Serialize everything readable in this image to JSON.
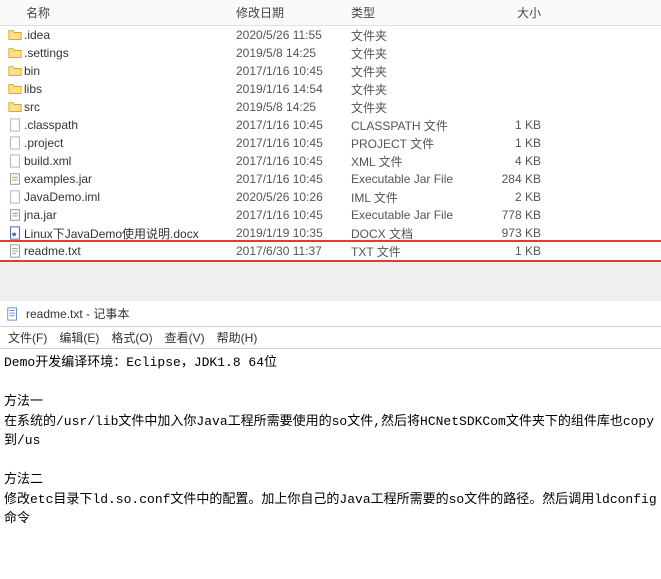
{
  "explorer": {
    "columns": {
      "name": "名称",
      "date": "修改日期",
      "type": "类型",
      "size": "大小"
    },
    "items": [
      {
        "icon": "folder",
        "name": ".idea",
        "date": "2020/5/26 11:55",
        "type": "文件夹",
        "size": ""
      },
      {
        "icon": "folder",
        "name": ".settings",
        "date": "2019/5/8 14:25",
        "type": "文件夹",
        "size": ""
      },
      {
        "icon": "folder",
        "name": "bin",
        "date": "2017/1/16 10:45",
        "type": "文件夹",
        "size": ""
      },
      {
        "icon": "folder",
        "name": "libs",
        "date": "2019/1/16 14:54",
        "type": "文件夹",
        "size": ""
      },
      {
        "icon": "folder",
        "name": "src",
        "date": "2019/5/8 14:25",
        "type": "文件夹",
        "size": ""
      },
      {
        "icon": "file",
        "name": ".classpath",
        "date": "2017/1/16 10:45",
        "type": "CLASSPATH 文件",
        "size": "1 KB"
      },
      {
        "icon": "file",
        "name": ".project",
        "date": "2017/1/16 10:45",
        "type": "PROJECT 文件",
        "size": "1 KB"
      },
      {
        "icon": "file",
        "name": "build.xml",
        "date": "2017/1/16 10:45",
        "type": "XML 文件",
        "size": "4 KB"
      },
      {
        "icon": "jar",
        "name": "examples.jar",
        "date": "2017/1/16 10:45",
        "type": "Executable Jar File",
        "size": "284 KB"
      },
      {
        "icon": "file",
        "name": "JavaDemo.iml",
        "date": "2020/5/26 10:26",
        "type": "IML 文件",
        "size": "2 KB"
      },
      {
        "icon": "jar",
        "name": "jna.jar",
        "date": "2017/1/16 10:45",
        "type": "Executable Jar File",
        "size": "778 KB"
      },
      {
        "icon": "docx",
        "name": "Linux下JavaDemo使用说明.docx",
        "date": "2019/1/19 10:35",
        "type": "DOCX 文档",
        "size": "973 KB"
      },
      {
        "icon": "txt",
        "name": "readme.txt",
        "date": "2017/6/30 11:37",
        "type": "TXT 文件",
        "size": "1 KB",
        "highlighted": true
      }
    ]
  },
  "notepad": {
    "title": "readme.txt - 记事本",
    "menus": [
      "文件(F)",
      "编辑(E)",
      "格式(O)",
      "查看(V)",
      "帮助(H)"
    ],
    "content": "Demo开发编译环境：Eclipse，JDK1.8 64位\n\n方法一\n在系统的/usr/lib文件中加入你Java工程所需要使用的so文件,然后将HCNetSDKCom文件夹下的组件库也copy到/us\n\n方法二\n修改etc目录下ld.so.conf文件中的配置。加上你自己的Java工程所需要的so文件的路径。然后调用ldconfig命令"
  }
}
